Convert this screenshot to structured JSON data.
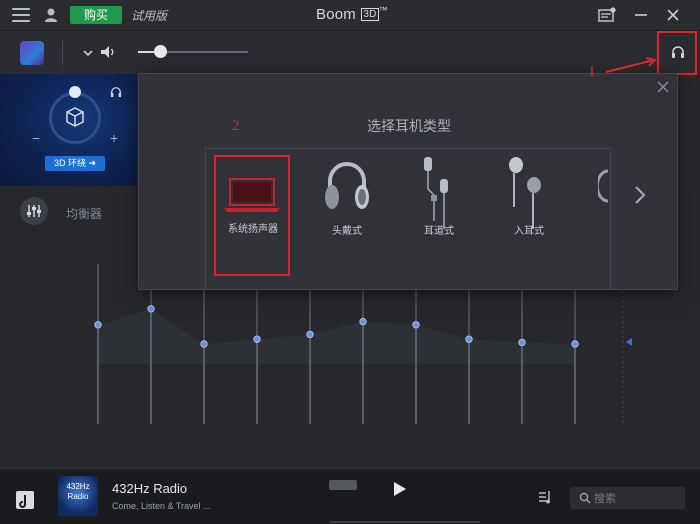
{
  "titlebar": {
    "buy_label": "购买",
    "trial_label": "试用版",
    "app_name": "Boom",
    "app_badge": "3D",
    "trademark": "™"
  },
  "toolbar": {
    "volume_level": 0.2
  },
  "surround": {
    "button_label": "3D 环绕 ➜",
    "minus": "−",
    "plus": "+"
  },
  "equalizer": {
    "label": "均衡器",
    "band_levels": [
      0.38,
      0.28,
      0.5,
      0.47,
      0.44,
      0.36,
      0.38,
      0.47,
      0.49,
      0.5
    ]
  },
  "modal": {
    "title": "选择耳机类型",
    "options": [
      {
        "label": "系统扬声器",
        "icon": "laptop-icon",
        "selected": true
      },
      {
        "label": "头戴式",
        "icon": "over-ear-headphone-icon",
        "selected": false
      },
      {
        "label": "耳道式",
        "icon": "in-ear-canal-icon",
        "selected": false
      },
      {
        "label": "入耳式",
        "icon": "earbud-icon",
        "selected": false
      }
    ]
  },
  "annotations": {
    "one": "1",
    "two": "2"
  },
  "player": {
    "track_title": "432Hz Radio",
    "track_subtitle": "Come, Listen & Travel ...",
    "album_text": "432Hz Radio",
    "search_placeholder": "搜索"
  },
  "colors": {
    "accent_red": "#e0242b",
    "buy_green": "#1f9a4c",
    "surround_blue": "#1d6fd6"
  }
}
